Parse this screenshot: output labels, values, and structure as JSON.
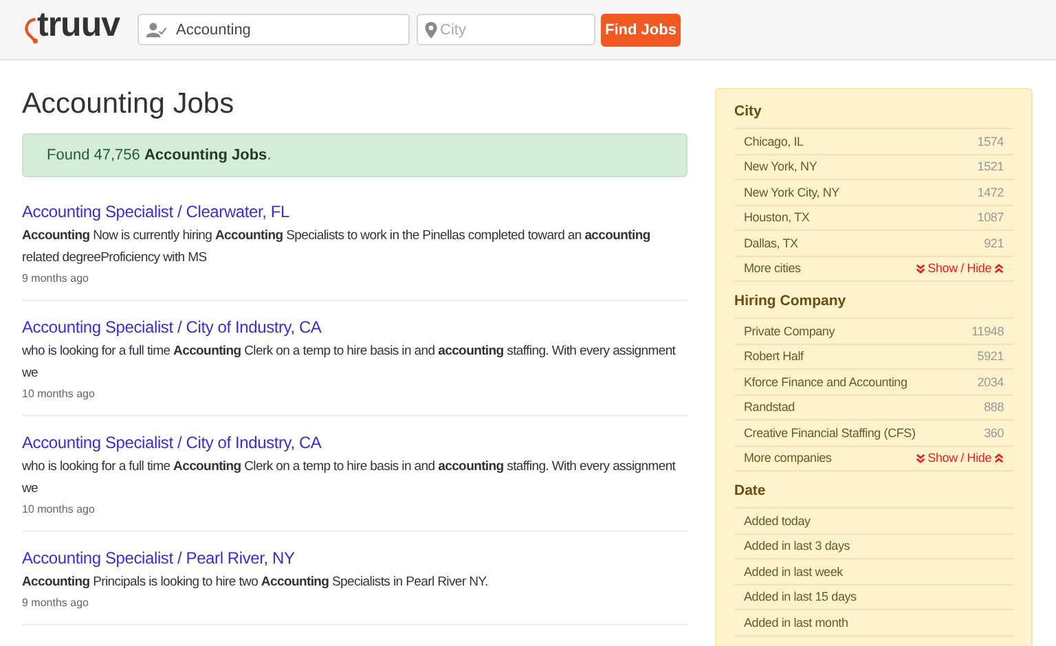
{
  "header": {
    "logo": "truuv",
    "query_field": {
      "value": "Accounting"
    },
    "location_field": {
      "placeholder": "City"
    },
    "search_button": "Find Jobs"
  },
  "title": "Accounting Jobs",
  "result_notice": "Found 47,756 **Accounting Jobs**.",
  "jobs": [
    {
      "title": "Accounting Specialist / Clearwater, FL",
      "snippet": "**Accounting** Now is currently hiring **Accounting** Specialists to work in the Pinellas completed toward an **accounting** related degreeProficiency with MS",
      "posted": "9 months ago"
    },
    {
      "title": "Accounting Specialist / City of Industry, CA",
      "snippet": "who is looking for a full time **Accounting** Clerk on a temp to hire basis in and **accounting** staffing. With every assignment we",
      "posted": "10 months ago"
    },
    {
      "title": "Accounting Specialist / City of Industry, CA",
      "snippet": "who is looking for a full time **Accounting** Clerk on a temp to hire basis in and **accounting** staffing. With every assignment we",
      "posted": "10 months ago"
    },
    {
      "title": "Accounting Specialist / Pearl River, NY",
      "snippet": "**Accounting** Principals is looking to hire two **Accounting** Specialists in Pearl River NY.",
      "posted": "9 months ago"
    }
  ],
  "sidebar": {
    "sections": [
      {
        "title": "City",
        "items": [
          {
            "label": "Chicago, IL",
            "count": "1574"
          },
          {
            "label": "New York, NY",
            "count": "1521"
          },
          {
            "label": "New York City, NY",
            "count": "1472"
          },
          {
            "label": "Houston, TX",
            "count": "1087"
          },
          {
            "label": "Dallas, TX",
            "count": "921"
          }
        ],
        "more": {
          "label": "More cities",
          "toggle": "Show / Hide"
        }
      },
      {
        "title": "Hiring Company",
        "items": [
          {
            "label": "Private Company",
            "count": "11948"
          },
          {
            "label": "Robert Half",
            "count": "5921"
          },
          {
            "label": "Kforce Finance and Accounting",
            "count": "2034"
          },
          {
            "label": "Randstad",
            "count": "888"
          },
          {
            "label": "Creative Financial Staffing (CFS)",
            "count": "360"
          }
        ],
        "more": {
          "label": "More companies",
          "toggle": "Show / Hide"
        }
      },
      {
        "title": "Date",
        "items": [
          {
            "label": "Added today"
          },
          {
            "label": "Added in last 3 days"
          },
          {
            "label": "Added in last week"
          },
          {
            "label": "Added in last 15 days"
          },
          {
            "label": "Added in last month"
          }
        ]
      }
    ]
  }
}
